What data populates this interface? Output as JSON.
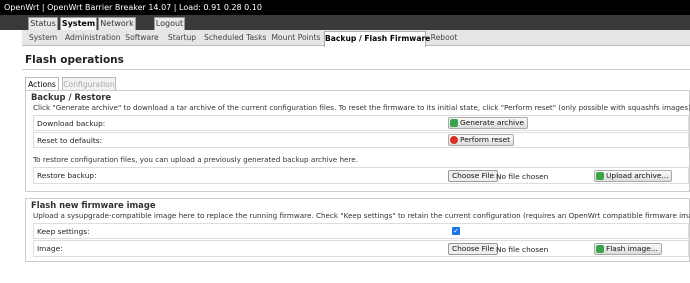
{
  "titlebar": {
    "text": "OpenWrt | OpenWrt Barrier Breaker 14.07 | Load: 0.91 0.28 0.10"
  },
  "main_tabs": [
    {
      "label": "Status"
    },
    {
      "label": "System"
    },
    {
      "label": "Network"
    },
    {
      "label": "Logout"
    }
  ],
  "sub_tabs": [
    {
      "label": "System"
    },
    {
      "label": "Administration"
    },
    {
      "label": "Software"
    },
    {
      "label": "Startup"
    },
    {
      "label": "Scheduled Tasks"
    },
    {
      "label": "Mount Points"
    },
    {
      "label": "Backup / Flash Firmware"
    },
    {
      "label": "Reboot"
    }
  ],
  "page": {
    "title": "Flash operations"
  },
  "content_tabs": [
    {
      "label": "Actions"
    },
    {
      "label": "Configuration"
    }
  ],
  "backup": {
    "legend": "Backup / Restore",
    "description": "Click \"Generate archive\" to download a tar archive of the current configuration files. To reset the firmware to its initial state, click \"Perform reset\" (only possible with squashfs images).",
    "download_label": "Download backup:",
    "generate_button": "Generate archive",
    "reset_label": "Reset to defaults:",
    "reset_button": "Perform reset",
    "restore_description": "To restore configuration files, you can upload a previously generated backup archive here.",
    "restore_label": "Restore backup:",
    "choose_file": "Choose File",
    "no_file": "No file chosen",
    "upload_button": "Upload archive..."
  },
  "flash": {
    "legend": "Flash new firmware image",
    "description": "Upload a sysupgrade-compatible image here to replace the running firmware. Check \"Keep settings\" to retain the current configuration (requires an OpenWrt compatible firmware image).",
    "keep_label": "Keep settings:",
    "keep_checked": true,
    "image_label": "Image:",
    "choose_file": "Choose File",
    "no_file": "No file chosen",
    "flash_button": "Flash image..."
  }
}
